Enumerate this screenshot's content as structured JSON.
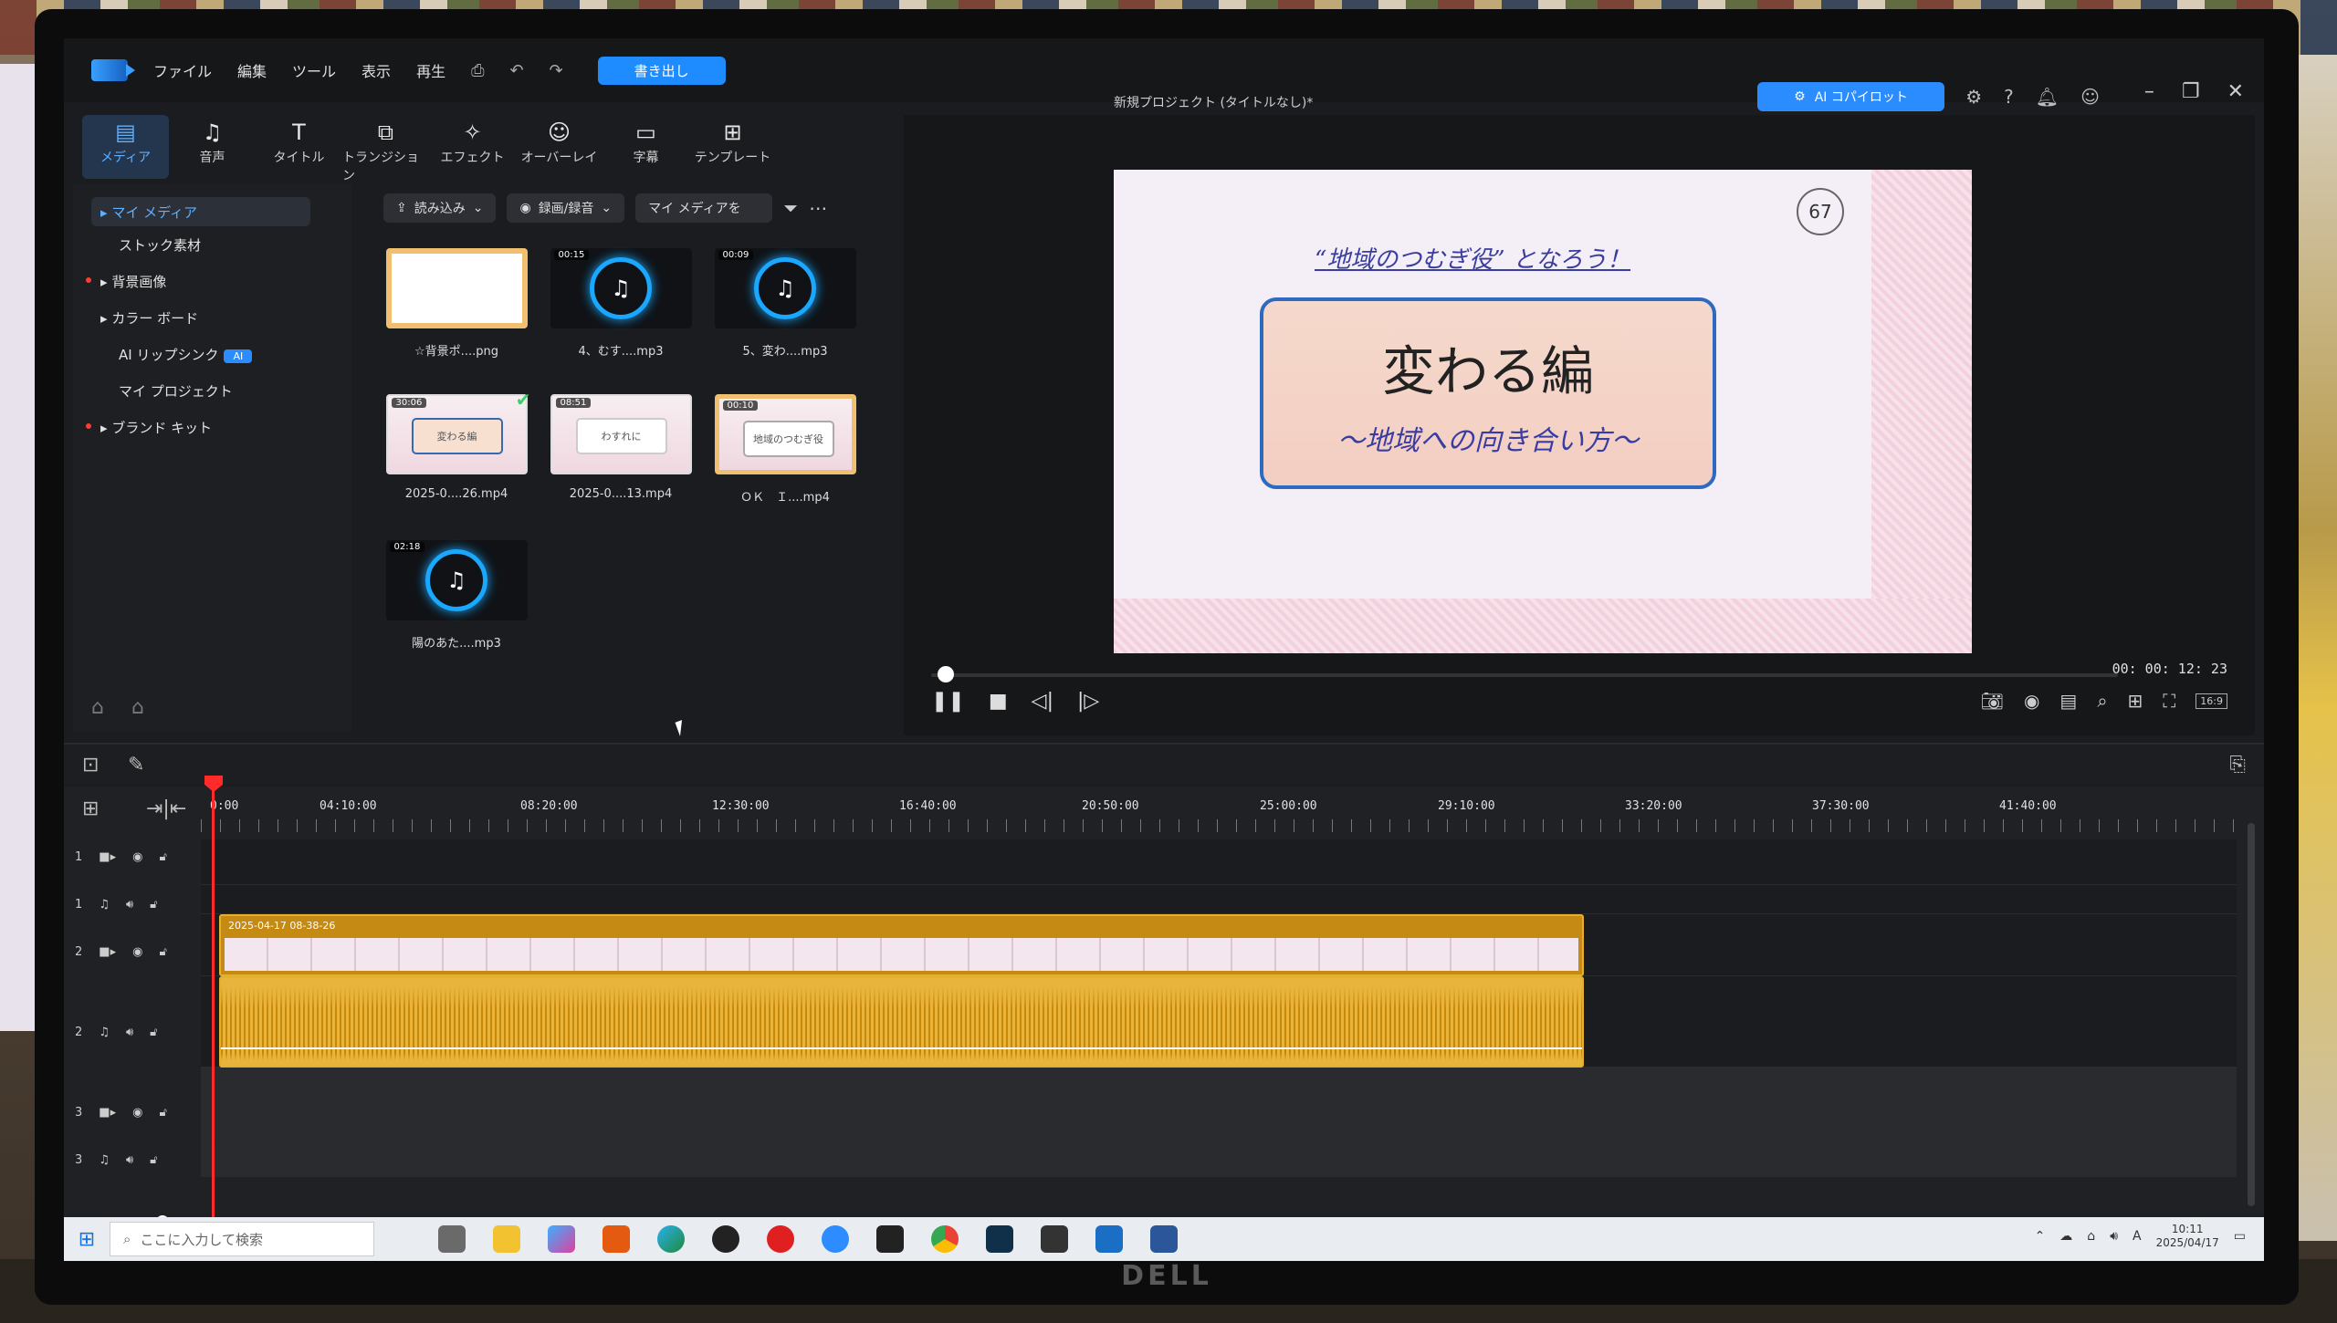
{
  "app": {
    "menu": [
      "ファイル",
      "編集",
      "ツール",
      "表示",
      "再生"
    ],
    "export_label": "書き出し",
    "project_title": "新規プロジェクト (タイトルなし)*",
    "ai_copilot_label": "AI コパイロット"
  },
  "module_tabs": [
    {
      "label": "メディア",
      "icon": "media-icon",
      "glyph": "▤"
    },
    {
      "label": "音声",
      "icon": "music-icon",
      "glyph": "♫"
    },
    {
      "label": "タイトル",
      "icon": "title-icon",
      "glyph": "T"
    },
    {
      "label": "トランジション",
      "icon": "transition-icon",
      "glyph": "⧉"
    },
    {
      "label": "エフェクト",
      "icon": "effect-icon",
      "glyph": "✧"
    },
    {
      "label": "オーバーレイ",
      "icon": "overlay-icon",
      "glyph": "☺"
    },
    {
      "label": "字幕",
      "icon": "subtitle-icon",
      "glyph": "▭"
    },
    {
      "label": "テンプレート",
      "icon": "template-icon",
      "glyph": "⊞"
    }
  ],
  "library": {
    "items": [
      "マイ メディア",
      "ストック素材",
      "背景画像",
      "カラー ボード",
      "AI リップシンク",
      "マイ プロジェクト",
      "ブランド キット"
    ],
    "ai_badge": "AI"
  },
  "media_toolbar": {
    "import_label": "読み込み",
    "record_label": "録画/録音",
    "search_placeholder": "マイ メディアを"
  },
  "media": [
    {
      "name": "☆背景ポ....png",
      "duration": "",
      "kind": "image"
    },
    {
      "name": "4、むす....mp3",
      "duration": "00:15",
      "kind": "audio"
    },
    {
      "name": "5、変わ....mp3",
      "duration": "00:09",
      "kind": "audio"
    },
    {
      "name": "2025-0....26.mp4",
      "duration": "30:06",
      "kind": "video"
    },
    {
      "name": "2025-0....13.mp4",
      "duration": "08:51",
      "kind": "video"
    },
    {
      "name": "ＯＫ　Ｉ....mp4",
      "duration": "00:10",
      "kind": "video"
    },
    {
      "name": "陽のあた....mp3",
      "duration": "02:18",
      "kind": "audio"
    }
  ],
  "preview": {
    "slide_number": "67",
    "slide_subtitle": "“地域のつむぎ役” となろう！",
    "slide_title": "変わる編",
    "slide_caption": "～地域への向き合い方～",
    "timecode": "00: 00: 12: 23",
    "aspect": "16:9",
    "progress_fraction": 0.01
  },
  "timeline": {
    "ruler": [
      "0:00",
      "04:10:00",
      "08:20:00",
      "12:30:00",
      "16:40:00",
      "20:50:00",
      "25:00:00",
      "29:10:00",
      "33:20:00",
      "37:30:00",
      "41:40:00"
    ],
    "tracks": [
      {
        "num": "1",
        "type": "video"
      },
      {
        "num": "1",
        "type": "audio"
      },
      {
        "num": "2",
        "type": "video"
      },
      {
        "num": "2",
        "type": "audio"
      },
      {
        "num": "3",
        "type": "video"
      },
      {
        "num": "3",
        "type": "audio"
      }
    ],
    "clip_label": "2025-04-17 08-38-26"
  },
  "taskbar": {
    "search_placeholder": "ここに入力して検索",
    "time": "10:11",
    "date": "2025/04/17",
    "ime": "A"
  },
  "colors": {
    "accent": "#1e8cff",
    "clip": "#e8b43c",
    "playhead": "#ff2a2a"
  }
}
